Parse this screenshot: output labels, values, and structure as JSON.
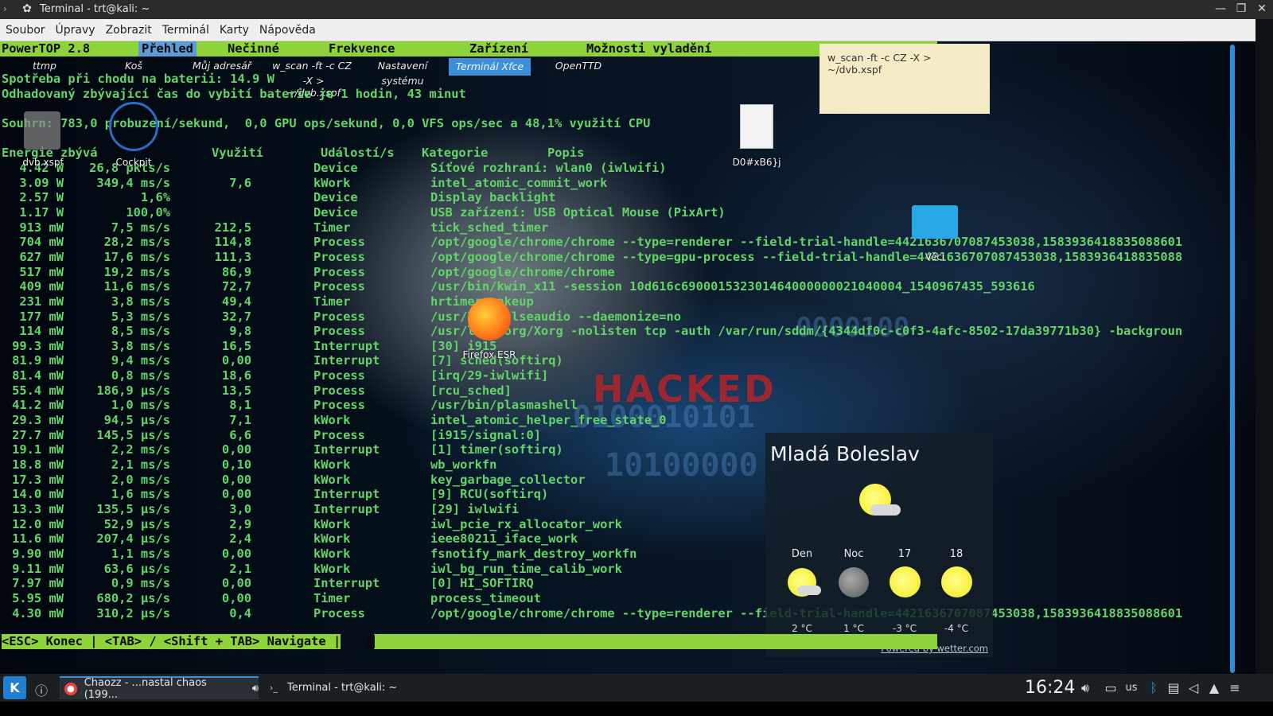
{
  "window": {
    "title": "Terminal - trt@kali: ~",
    "buttons": {
      "minimize": "—",
      "maximize": "❐",
      "close": "✕"
    }
  },
  "menu": [
    "Soubor",
    "Úpravy",
    "Zobrazit",
    "Terminál",
    "Karty",
    "Nápověda"
  ],
  "powertop": {
    "version": "PowerTOP 2.8",
    "tabs": [
      "Přehled",
      "Nečinné",
      "Frekvence",
      "Zařízení",
      "Možnosti vyladění"
    ],
    "active_tab": "Přehled",
    "line1": "Spotřeba při chodu na baterii: 14.9 W",
    "line2": "Odhadovaný zbývající čas do vybití baterie je 1 hodin, 43 minut",
    "summary": "Souhrn: 783,0 probuzení/sekund,  0,0 GPU ops/sekund, 0,0 VFS ops/sec a 48,1% využití CPU",
    "headers": [
      "Energie zbývá",
      "Využití",
      "Událostí/s",
      "Kategorie",
      "Popis"
    ],
    "rows": [
      [
        "4.42 W",
        "26,8 pkts/s",
        "",
        "Device",
        "Síťové rozhraní: wlan0 (iwlwifi)"
      ],
      [
        "3.09 W",
        "349,4 ms/s",
        "7,6",
        "kWork",
        "intel_atomic_commit_work"
      ],
      [
        "2.57 W",
        "1,6%",
        "",
        "Device",
        "Display backlight"
      ],
      [
        "1.17 W",
        "100,0%",
        "",
        "Device",
        "USB zařízení: USB Optical Mouse (PixArt)"
      ],
      [
        "913 mW",
        "7,5 ms/s",
        "212,5",
        "Timer",
        "tick_sched_timer"
      ],
      [
        "704 mW",
        "28,2 ms/s",
        "114,8",
        "Process",
        "/opt/google/chrome/chrome --type=renderer --field-trial-handle=4421636707087453038,1583936418835088601"
      ],
      [
        "627 mW",
        "17,6 ms/s",
        "111,3",
        "Process",
        "/opt/google/chrome/chrome --type=gpu-process --field-trial-handle=4421636707087453038,1583936418835088"
      ],
      [
        "517 mW",
        "19,2 ms/s",
        "86,9",
        "Process",
        "/opt/google/chrome/chrome"
      ],
      [
        "409 mW",
        "11,6 ms/s",
        "72,7",
        "Process",
        "/usr/bin/kwin_x11 -session 10d616c690001532301464000000021040004_1540967435_593616"
      ],
      [
        "231 mW",
        "3,8 ms/s",
        "49,4",
        "Timer",
        "hrtimer_wakeup"
      ],
      [
        "177 mW",
        "5,3 ms/s",
        "32,7",
        "Process",
        "/usr/bin/pulseaudio --daemonize=no"
      ],
      [
        "114 mW",
        "8,5 ms/s",
        "9,8",
        "Process",
        "/usr/lib/xorg/Xorg -nolisten tcp -auth /var/run/sddm/{4344df0c-c0f3-4afc-8502-17da39771b30} -backgroun"
      ],
      [
        "99.3 mW",
        "3,8 ms/s",
        "16,5",
        "Interrupt",
        "[30] i915"
      ],
      [
        "81.9 mW",
        "9,4 ms/s",
        "0,00",
        "Interrupt",
        "[7] sched(softirq)"
      ],
      [
        "81.4 mW",
        "0,8 ms/s",
        "18,6",
        "Process",
        "[irq/29-iwlwifi]"
      ],
      [
        "55.4 mW",
        "186,9 µs/s",
        "13,5",
        "Process",
        "[rcu_sched]"
      ],
      [
        "41.2 mW",
        "1,0 ms/s",
        "8,1",
        "Process",
        "/usr/bin/plasmashell"
      ],
      [
        "29.3 mW",
        "94,5 µs/s",
        "7,1",
        "kWork",
        "intel_atomic_helper_free_state_0"
      ],
      [
        "27.7 mW",
        "145,5 µs/s",
        "6,6",
        "Process",
        "[i915/signal:0]"
      ],
      [
        "19.1 mW",
        "2,2 ms/s",
        "0,00",
        "Interrupt",
        "[1] timer(softirq)"
      ],
      [
        "18.8 mW",
        "2,1 ms/s",
        "0,10",
        "kWork",
        "wb_workfn"
      ],
      [
        "17.3 mW",
        "2,0 ms/s",
        "0,00",
        "kWork",
        "key_garbage_collector"
      ],
      [
        "14.0 mW",
        "1,6 ms/s",
        "0,00",
        "Interrupt",
        "[9] RCU(softirq)"
      ],
      [
        "13.3 mW",
        "135,5 µs/s",
        "3,0",
        "Interrupt",
        "[29] iwlwifi"
      ],
      [
        "12.0 mW",
        "52,9 µs/s",
        "2,9",
        "kWork",
        "iwl_pcie_rx_allocator_work"
      ],
      [
        "11.6 mW",
        "207,4 µs/s",
        "2,4",
        "kWork",
        "ieee80211_iface_work"
      ],
      [
        "9.90 mW",
        "1,1 ms/s",
        "0,00",
        "kWork",
        "fsnotify_mark_destroy_workfn"
      ],
      [
        "9.11 mW",
        "63,6 µs/s",
        "2,1",
        "kWork",
        "iwl_bg_run_time_calib_work"
      ],
      [
        "7.97 mW",
        "0,9 ms/s",
        "0,00",
        "Interrupt",
        "[0] HI_SOFTIRQ"
      ],
      [
        "5.95 mW",
        "680,2 µs/s",
        "0,00",
        "Timer",
        "process_timeout"
      ],
      [
        "4.30 mW",
        "310,2 µs/s",
        "0,4",
        "Process",
        "/opt/google/chrome/chrome --type=renderer --field-trial-handle=4421636707087453038,1583936418835088601"
      ]
    ],
    "footer": "<ESC> Konec | <TAB> / <Shift + TAB> Navigate |"
  },
  "panel_items": {
    "p1": "ttmp",
    "p2": "Koš",
    "p3": "Můj adresář",
    "p4a": "w_scan -ft -c CZ",
    "p4b": "-X > ~/dvb.xspf",
    "p5a": "Nastavení",
    "p5b": "systému",
    "p6": "Terminál Xfce",
    "p7": "OpenTTD"
  },
  "desktop_labels": {
    "dvb": "dvb.xspf",
    "cockpit": "Cockpit",
    "doc": "D0#xB6}j",
    "folder": "Věci",
    "firefox": "Firefox ESR"
  },
  "bg_text": {
    "hacked": "HACKED"
  },
  "note": {
    "text": "w_scan -ft -c CZ -X > ~/dvb.xspf"
  },
  "weather": {
    "city": "Mladá Boleslav",
    "days": [
      {
        "label": "Den",
        "temp": "2 °C",
        "icon": "partly-cloudy-sun"
      },
      {
        "label": "Noc",
        "temp": "1 °C",
        "icon": "moon"
      },
      {
        "label": "17",
        "temp": "-3 °C",
        "icon": "sun"
      },
      {
        "label": "18",
        "temp": "-4 °C",
        "icon": "sun"
      }
    ],
    "powered": "Powered by wetter.com"
  },
  "taskbar": {
    "launcher": "K",
    "task1": "Chaozz - ...nastal chaos (199...",
    "task2": "Terminal - trt@kali: ~",
    "clock": "16:24",
    "tray_lang": "us"
  },
  "colors": {
    "terminal_green": "#63d36a",
    "powertop_bar": "#8fd33a",
    "active_tab": "#5a9bd8",
    "accent_blue": "#3d8fd8"
  }
}
